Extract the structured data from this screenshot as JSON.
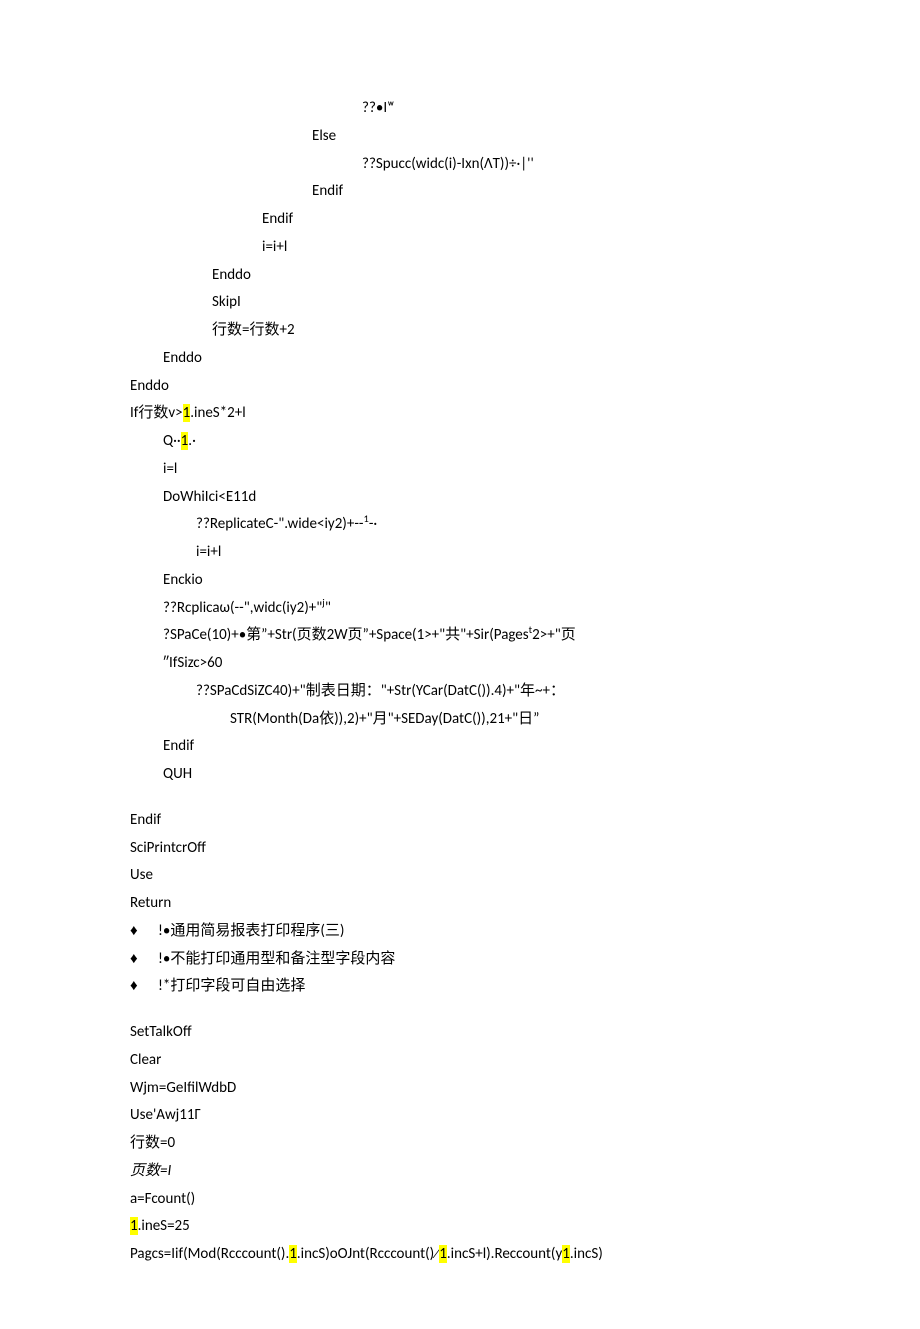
{
  "lines": [
    {
      "indent": 232,
      "text": "??•Iʷ"
    },
    {
      "indent": 182,
      "text": "Else"
    },
    {
      "indent": 232,
      "text": "??Spucc(widc(i)-Ixn(ΛT))÷·|''"
    },
    {
      "indent": 182,
      "text": "Endif"
    },
    {
      "indent": 132,
      "text": "Endif"
    },
    {
      "indent": 132,
      "text": "i=i+l"
    },
    {
      "indent": 82,
      "text": "Enddo"
    },
    {
      "indent": 82,
      "text": "SkipI"
    },
    {
      "indent": 82,
      "text": "行数=行数+2"
    },
    {
      "indent": 33,
      "text": "Enddo"
    },
    {
      "indent": 0,
      "text": "Enddo"
    },
    {
      "indent": 0,
      "segments": [
        {
          "t": "If行数v>"
        },
        {
          "t": "1",
          "hl": true
        },
        {
          "t": ".ineS*2+l"
        }
      ]
    },
    {
      "indent": 33,
      "segments": [
        {
          "t": "Q··"
        },
        {
          "t": "1",
          "hl": true
        },
        {
          "t": ".·"
        }
      ]
    },
    {
      "indent": 33,
      "text": "i=l"
    },
    {
      "indent": 33,
      "text": "DoWhiIci<E11d"
    },
    {
      "indent": 66,
      "segments": [
        {
          "t": "??ReplicateC-\".wide<iy2)+--"
        },
        {
          "t": "1",
          "sup": true
        },
        {
          "t": "-·"
        }
      ]
    },
    {
      "indent": 66,
      "text": "i=i+l"
    },
    {
      "indent": 33,
      "text": "Enckio"
    },
    {
      "indent": 33,
      "segments": [
        {
          "t": "??Rcplicaω(--\",widc(iy2)+\""
        },
        {
          "t": "j",
          "sup": true
        },
        {
          "t": "\""
        }
      ]
    },
    {
      "indent": 33,
      "segments": [
        {
          "t": "?SPaCe(10)+•第”+Str(页数2W页”+Space(1>+\"共\"+Sir(Pages"
        },
        {
          "t": "t",
          "sup": true
        },
        {
          "t": "2>+\"页"
        }
      ]
    },
    {
      "indent": 33,
      "text": "″IfSizc>60"
    },
    {
      "indent": 66,
      "text": "??SPaCdSiZC40)+\"制表日期：\"+Str(YCar(DatC()).4)+\"年~+："
    },
    {
      "indent": 100,
      "text": "STR(Month(Da依)),2)+\"月\"+SEDay(DatC()),21+\"日”"
    },
    {
      "indent": 33,
      "text": "Endif"
    },
    {
      "indent": 33,
      "text": "QUH"
    }
  ],
  "linesAfterGap": [
    {
      "indent": 0,
      "text": "Endif"
    },
    {
      "indent": 0,
      "text": "SciPrintcrOff"
    },
    {
      "indent": 0,
      "text": "Use"
    },
    {
      "indent": 0,
      "text": "Return"
    }
  ],
  "bullets": [
    "!•通用简易报表打印程序(三)",
    "!•不能打印通用型和备注型字段内容",
    "!*打印字段可自由选择"
  ],
  "lines2": [
    {
      "indent": 0,
      "text": "SetTalkOff"
    },
    {
      "indent": 0,
      "text": "Clear"
    },
    {
      "indent": 0,
      "text": "Wjm=GeIfilWdbD"
    },
    {
      "indent": 0,
      "text": "Use'Awj11Γ"
    },
    {
      "indent": 0,
      "text": "行数=0"
    },
    {
      "indent": 0,
      "text": "页数=I",
      "italic": true
    },
    {
      "indent": 0,
      "text": "a=Fcount()"
    },
    {
      "indent": 0,
      "segments": [
        {
          "t": "1",
          "hl": true
        },
        {
          "t": ".ineS=25"
        }
      ]
    },
    {
      "indent": 0,
      "segments": [
        {
          "t": "Pagcs=Iif(Mod(Rcccount()."
        },
        {
          "t": "1",
          "hl": true
        },
        {
          "t": ".incS)oOJnt(Rcccount()∕"
        },
        {
          "t": "1",
          "hl": true
        },
        {
          "t": ".incS+l).Reccount(y"
        },
        {
          "t": "1",
          "hl": true
        },
        {
          "t": ".incS)"
        }
      ]
    }
  ]
}
